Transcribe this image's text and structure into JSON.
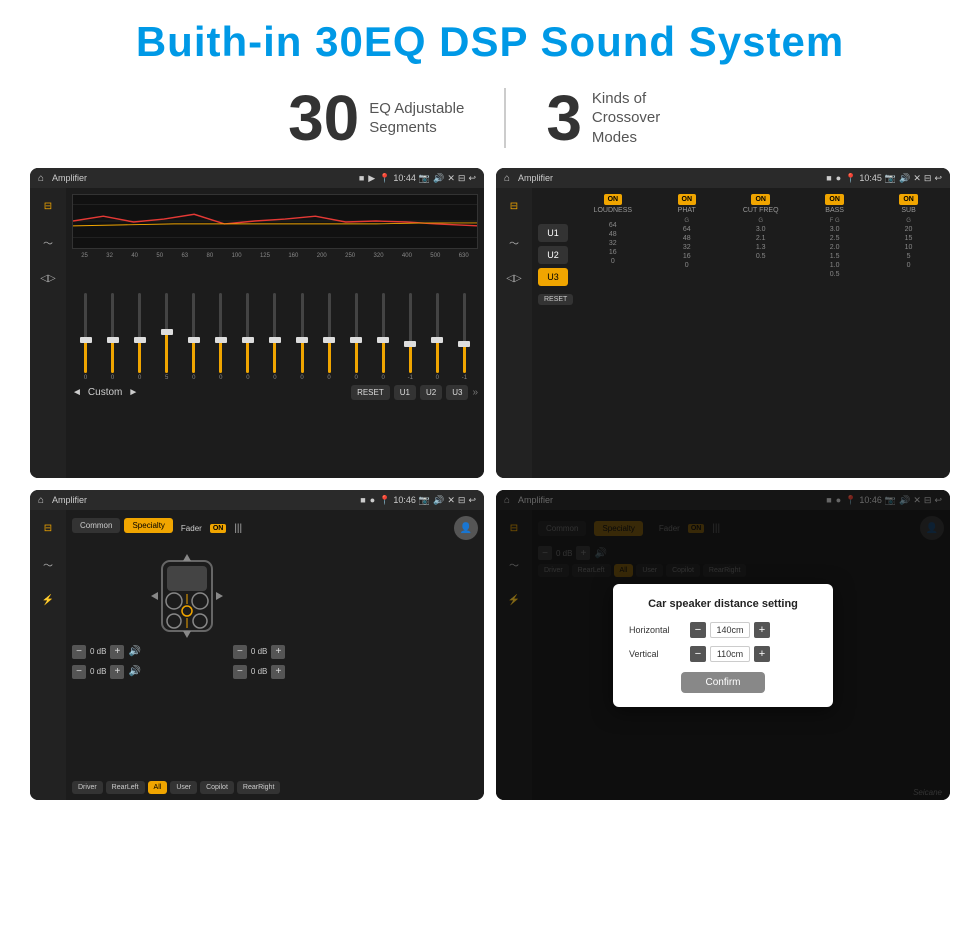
{
  "header": {
    "title": "Buith-in 30EQ DSP Sound System"
  },
  "stats": [
    {
      "number": "30",
      "text": "EQ Adjustable\nSegments"
    },
    {
      "number": "3",
      "text": "Kinds of\nCrossover Modes"
    }
  ],
  "screen1": {
    "status_bar": {
      "title": "Amplifier",
      "time": "10:44"
    },
    "freq_labels": [
      "25",
      "32",
      "40",
      "50",
      "63",
      "80",
      "100",
      "125",
      "160",
      "200",
      "250",
      "320",
      "400",
      "500",
      "630"
    ],
    "sliders": [
      {
        "pos": 50,
        "val": "0"
      },
      {
        "pos": 50,
        "val": "0"
      },
      {
        "pos": 50,
        "val": "0"
      },
      {
        "pos": 55,
        "val": "5"
      },
      {
        "pos": 50,
        "val": "0"
      },
      {
        "pos": 50,
        "val": "0"
      },
      {
        "pos": 50,
        "val": "0"
      },
      {
        "pos": 50,
        "val": "0"
      },
      {
        "pos": 50,
        "val": "0"
      },
      {
        "pos": 50,
        "val": "0"
      },
      {
        "pos": 50,
        "val": "0"
      },
      {
        "pos": 50,
        "val": "0"
      },
      {
        "pos": 45,
        "val": "-1"
      },
      {
        "pos": 50,
        "val": "0"
      },
      {
        "pos": 45,
        "val": "-1"
      }
    ],
    "buttons": [
      "Custom",
      "RESET",
      "U1",
      "U2",
      "U3"
    ]
  },
  "screen2": {
    "status_bar": {
      "title": "Amplifier",
      "time": "10:45"
    },
    "u_buttons": [
      "U1",
      "U2",
      "U3"
    ],
    "active_u": "U3",
    "cols": [
      {
        "on": true,
        "label": "LOUDNESS",
        "sublabel": ""
      },
      {
        "on": true,
        "label": "PHAT",
        "sublabel": "G"
      },
      {
        "on": true,
        "label": "CUT FREQ",
        "sublabel": "G"
      },
      {
        "on": true,
        "label": "BASS",
        "sublabel": "F  G"
      },
      {
        "on": true,
        "label": "SUB",
        "sublabel": "G"
      }
    ],
    "reset_label": "RESET"
  },
  "screen3": {
    "status_bar": {
      "title": "Amplifier",
      "time": "10:46"
    },
    "tabs": [
      "Common",
      "Specialty"
    ],
    "active_tab": "Specialty",
    "fader_label": "Fader",
    "fader_on": "ON",
    "db_values": [
      "0 dB",
      "0 dB",
      "0 dB",
      "0 dB"
    ],
    "bottom_buttons": [
      "Driver",
      "RearLeft",
      "All",
      "User",
      "Copilot",
      "RearRight"
    ]
  },
  "screen4": {
    "status_bar": {
      "title": "Amplifier",
      "time": "10:46"
    },
    "tabs": [
      "Common",
      "Specialty"
    ],
    "active_tab": "Specialty",
    "dialog": {
      "title": "Car speaker distance setting",
      "rows": [
        {
          "label": "Horizontal",
          "value": "140cm"
        },
        {
          "label": "Vertical",
          "value": "110cm"
        }
      ],
      "confirm_label": "Confirm"
    },
    "db_values": [
      "0 dB",
      "0 dB"
    ],
    "bottom_buttons": [
      "Driver",
      "RearLeft",
      "All",
      "User",
      "Copilot",
      "RearRight"
    ]
  },
  "watermark": "Seicane"
}
